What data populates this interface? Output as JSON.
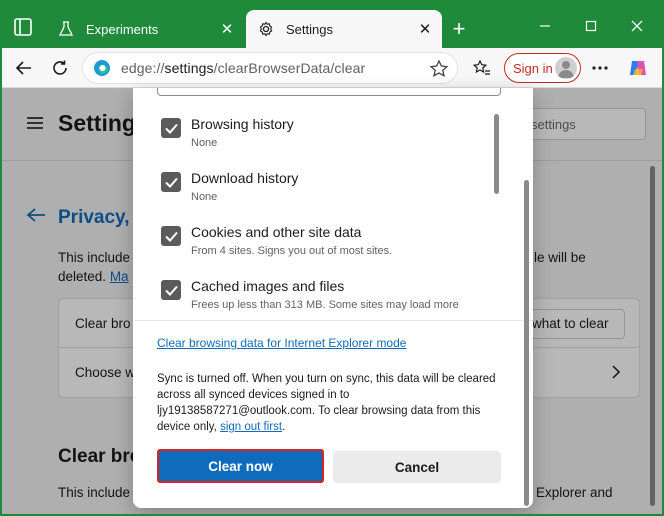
{
  "tabs": [
    {
      "label": "Experiments",
      "icon": "flask-icon",
      "active": false
    },
    {
      "label": "Settings",
      "icon": "gear-icon",
      "active": true
    }
  ],
  "toolbar": {
    "url_scheme": "edge://",
    "url_host": "settings",
    "url_path": "/clearBrowserData/clear",
    "signin_label": "Sign in"
  },
  "background_page": {
    "header_title": "Settings",
    "search_placeholder": "settings",
    "section_title": "Privacy,",
    "intro_line1": "This include",
    "intro_line1_end": "le will be",
    "intro_line2_start": "deleted.",
    "intro_link": "Ma",
    "clear_row_label": "Clear bro",
    "clear_button": "what to clear",
    "choose_row_label": "Choose w",
    "section2_title": "Clear bro",
    "section2_line": "This include",
    "section2_line_end": "Explorer and"
  },
  "dialog": {
    "items": [
      {
        "title": "Browsing history",
        "subtitle": "None",
        "checked": true
      },
      {
        "title": "Download history",
        "subtitle": "None",
        "checked": true
      },
      {
        "title": "Cookies and other site data",
        "subtitle": "From 4 sites. Signs you out of most sites.",
        "checked": true
      },
      {
        "title": "Cached images and files",
        "subtitle": "Frees up less than 313 MB. Some sites may load more",
        "checked": true
      }
    ],
    "ie_link": "Clear browsing data for Internet Explorer mode",
    "sync_text_1": "Sync is turned off. When you turn on sync, this data will be cleared across all synced devices signed in to ljy19138587271@outlook.com. To clear browsing data from this device only, ",
    "sync_link": "sign out first",
    "sync_text_2": ".",
    "primary_button": "Clear now",
    "secondary_button": "Cancel"
  },
  "colors": {
    "frame": "#1f8a3a",
    "accent": "#0f6cbd",
    "highlight": "#e0201a",
    "signin": "#c42b1c"
  }
}
